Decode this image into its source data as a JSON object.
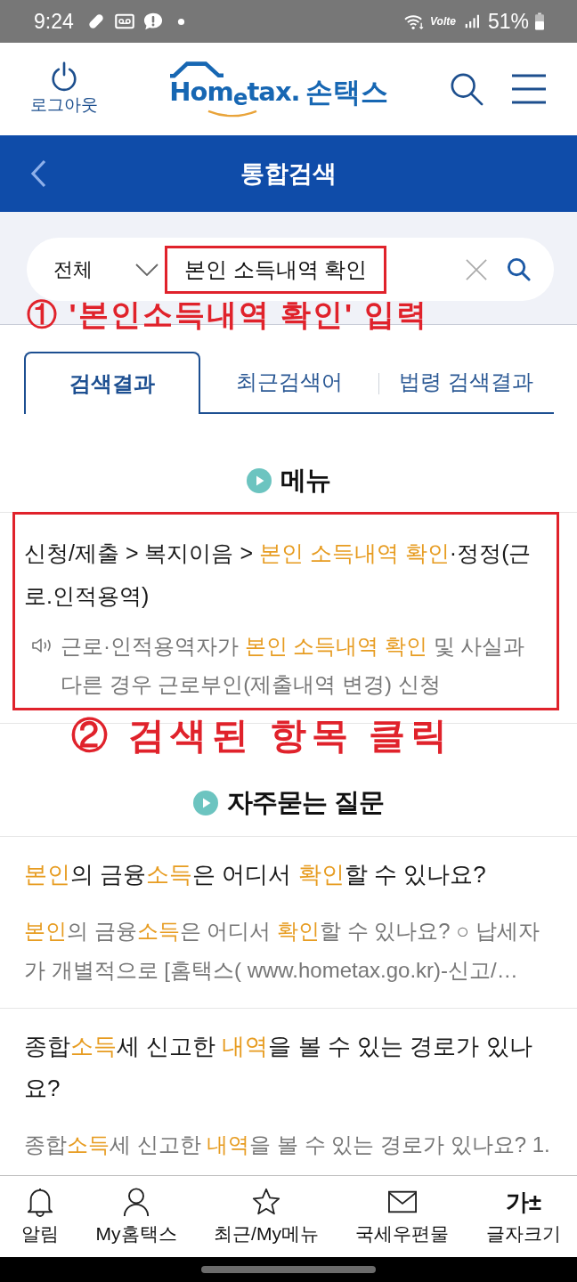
{
  "status_bar": {
    "time": "9:24",
    "network": "Volte",
    "battery": "51%"
  },
  "header": {
    "logout_label": "로그아웃",
    "logo_text": "Hom$_{e}$tax.",
    "app_name": "손택스"
  },
  "title_bar": {
    "title": "통합검색"
  },
  "search": {
    "scope": "전체",
    "value": "본인 소득내역 확인",
    "annotated": true,
    "note": "① '본인소득내역 확인' 입력"
  },
  "tabs": [
    {
      "label": "검색결과",
      "selected": true
    },
    {
      "label": "최근검색어",
      "selected": false
    },
    {
      "label": "법령 검색결과",
      "selected": false
    }
  ],
  "menu_section": {
    "heading": "메뉴",
    "results": [
      {
        "annotated": true,
        "path": [
          {
            "text": "신청/제출 > 복지이음 > ",
            "highlight": false
          },
          {
            "text": "본인 소득내역 확인",
            "highlight": true
          },
          {
            "text": "·정정(근로.인적용역)",
            "highlight": false
          }
        ],
        "description": [
          {
            "text": "근로·인적용역자가 ",
            "highlight": false
          },
          {
            "text": "본인 소득내역 확인",
            "highlight": true
          },
          {
            "text": " 및 사실과 다른 경우 근로부인(제출내역 변경) 신청",
            "highlight": false
          }
        ]
      }
    ],
    "note": "② 검색된 항목 클릭"
  },
  "faq_section": {
    "heading": "자주묻는 질문",
    "items": [
      {
        "title": [
          {
            "text": "본인",
            "highlight": true
          },
          {
            "text": "의 금융",
            "highlight": false
          },
          {
            "text": "소득",
            "highlight": true
          },
          {
            "text": "은 어디서 ",
            "highlight": false
          },
          {
            "text": "확인",
            "highlight": true
          },
          {
            "text": "할 수 있나요?",
            "highlight": false
          }
        ],
        "snippet": [
          {
            "text": "본인",
            "highlight": true
          },
          {
            "text": "의 금융",
            "highlight": false
          },
          {
            "text": "소득",
            "highlight": true
          },
          {
            "text": "은 어디서 ",
            "highlight": false
          },
          {
            "text": "확인",
            "highlight": true
          },
          {
            "text": "할 수 있나요? ○ 납세자가 개별적으로 [홈택스( www.hometax.go.kr)-신고/…",
            "highlight": false
          }
        ]
      },
      {
        "title": [
          {
            "text": "종합",
            "highlight": false
          },
          {
            "text": "소득",
            "highlight": true
          },
          {
            "text": "세 신고한 ",
            "highlight": false
          },
          {
            "text": "내역",
            "highlight": true
          },
          {
            "text": "을 볼 수 있는 경로가 있나요?",
            "highlight": false
          }
        ],
        "snippet": [
          {
            "text": "종합",
            "highlight": false
          },
          {
            "text": "소득",
            "highlight": true
          },
          {
            "text": "세 신고한 ",
            "highlight": false
          },
          {
            "text": "내역",
            "highlight": true
          },
          {
            "text": "을 볼 수 있는 경로가 있나요? 1.",
            "highlight": false
          }
        ]
      }
    ]
  },
  "bottom_nav": [
    {
      "label": "알림"
    },
    {
      "label": "My홈택스"
    },
    {
      "label": "최근/My메뉴"
    },
    {
      "label": "국세우편물"
    },
    {
      "label": "글자크기",
      "glyph": "가±"
    }
  ]
}
